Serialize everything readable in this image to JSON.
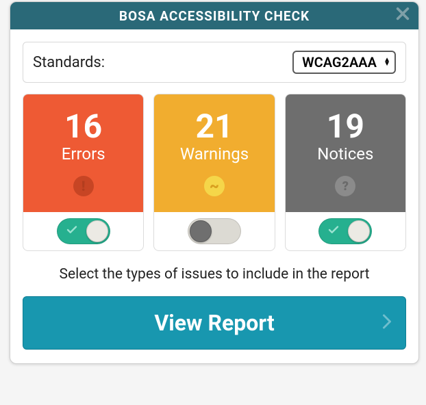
{
  "titlebar": {
    "title": "BOSA ACCESSIBILITY CHECK"
  },
  "standards": {
    "label": "Standards:",
    "selected": "WCAG2AAA"
  },
  "cards": {
    "errors": {
      "count": "16",
      "label": "Errors",
      "toggle_on": true,
      "badge_glyph": "!"
    },
    "warnings": {
      "count": "21",
      "label": "Warnings",
      "toggle_on": false,
      "badge_glyph": "~"
    },
    "notices": {
      "count": "19",
      "label": "Notices",
      "toggle_on": true,
      "badge_glyph": "?"
    }
  },
  "instruction": "Select the types of issues to include in the report",
  "view_report_label": "View Report"
}
